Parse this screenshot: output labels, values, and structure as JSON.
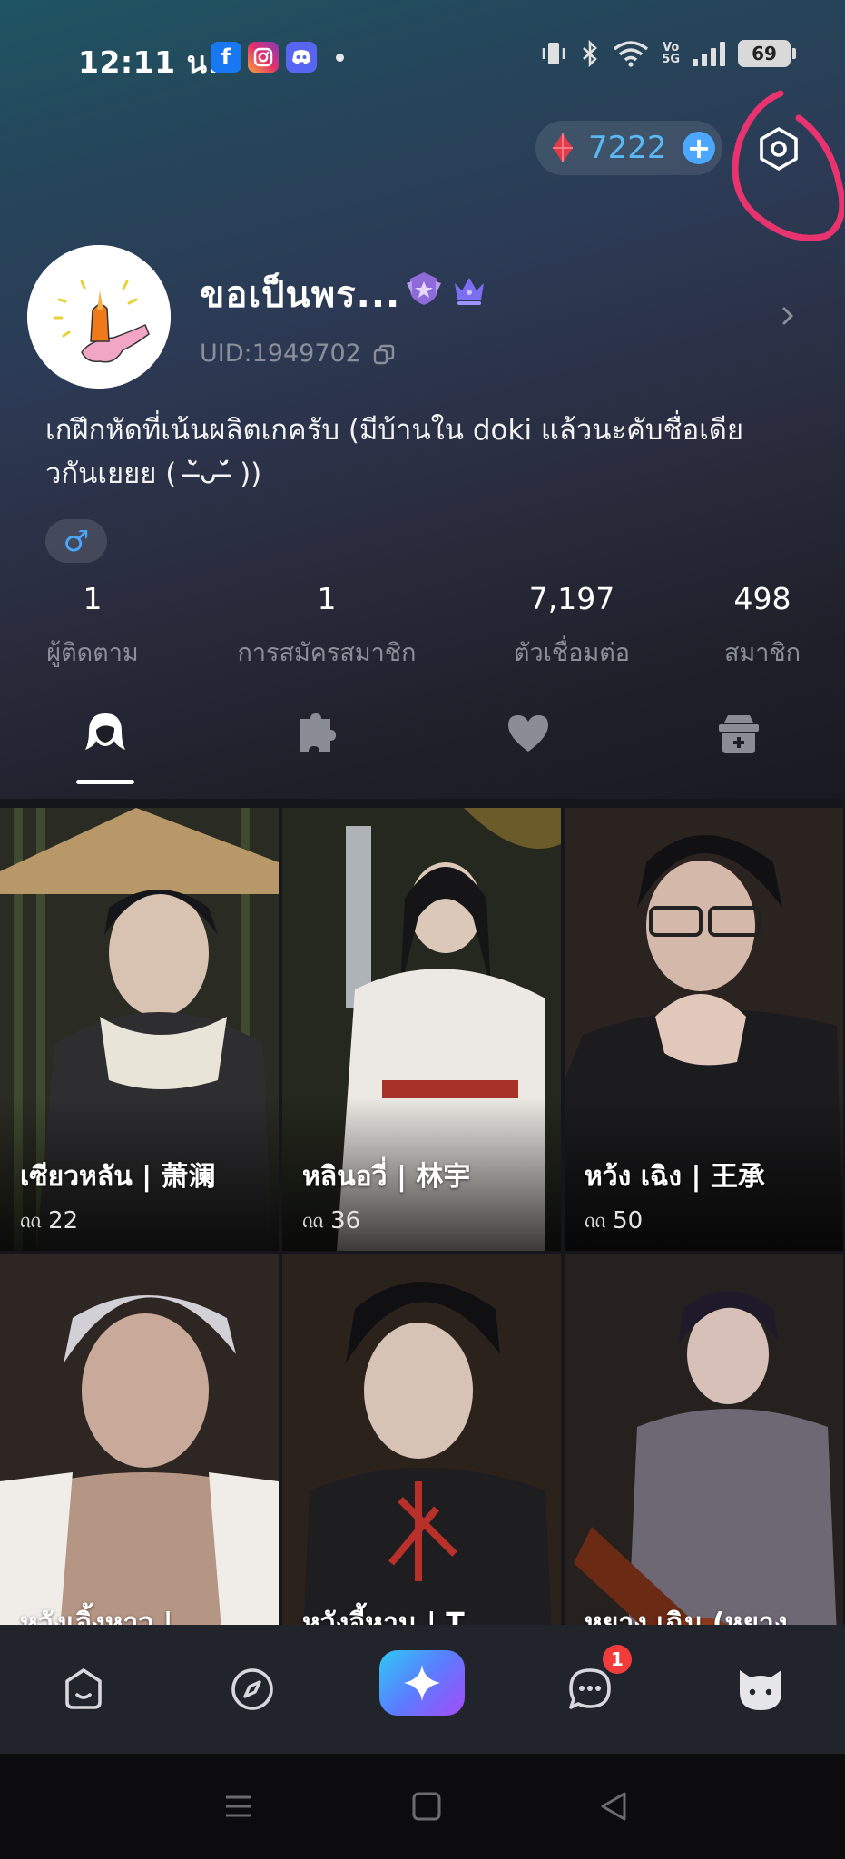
{
  "status_bar": {
    "time": "12:11 น.",
    "app_icons": [
      "facebook-icon",
      "instagram-icon",
      "discord-icon"
    ],
    "network_label_top": "Vo",
    "network_label_bottom": "5G",
    "battery": "69"
  },
  "wallet": {
    "gem_count": "7222",
    "add_label": "+"
  },
  "profile": {
    "username": "ขอเป็นพร...",
    "uid": "UID:1949702",
    "bio": "เกฝึกหัดที่เน้นผลิตเกครับ (มีบ้านใน doki แล้วนะคับชื่อเดียวกันเยยย ( ˘̶̀ᴗ˘̶́ ))",
    "gender_symbol": "♂"
  },
  "stats": [
    {
      "value": "1",
      "label": "ผู้ติดตาม"
    },
    {
      "value": "1",
      "label": "การสมัครสมาชิก"
    },
    {
      "value": "7,197",
      "label": "ตัวเชื่อมต่อ"
    },
    {
      "value": "498",
      "label": "สมาชิก"
    }
  ],
  "tabs": [
    "characters-tab-icon",
    "puzzle-tab-icon",
    "heart-tab-icon",
    "chest-tab-icon"
  ],
  "characters": [
    {
      "title": "เซียวหลัน |  萧澜",
      "chats": "22"
    },
    {
      "title": "หลินอวี่ | 林宇",
      "chats": "36"
    },
    {
      "title": "หว้ง เฉิง | 王承",
      "chats": "50"
    },
    {
      "title": "หวังเจิ้งหาว |",
      "chats": ""
    },
    {
      "title": "หวังอี้หาน | T",
      "chats": ""
    },
    {
      "title": "หยาง เฉิน (หยาง",
      "chats": ""
    }
  ],
  "bottom_nav": {
    "items": [
      "home-icon",
      "discover-icon",
      "create-icon",
      "messages-icon",
      "profile-icon"
    ],
    "unread_count": "1"
  },
  "colors": {
    "gem_text": "#5ab8f5",
    "accent_blue": "#4ba7ff",
    "annotation_pink": "#e8336f",
    "badge_red": "#f23b3b"
  }
}
